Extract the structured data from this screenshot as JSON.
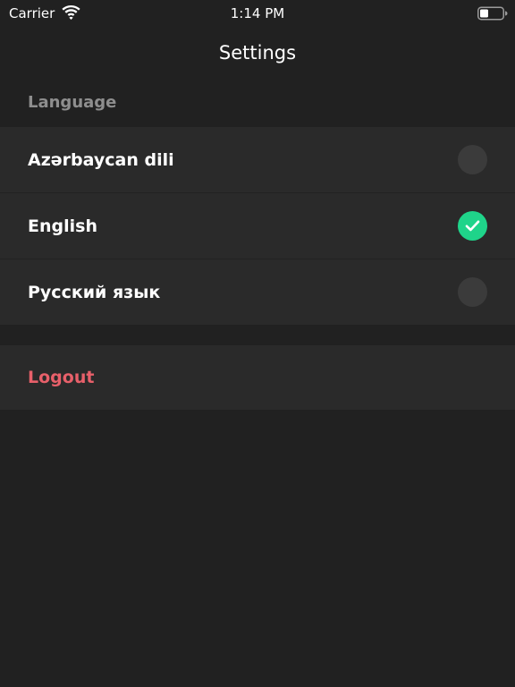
{
  "status_bar": {
    "carrier": "Carrier",
    "time": "1:14 PM",
    "wifi_icon": "wifi-icon",
    "battery_icon": "battery-icon"
  },
  "header": {
    "title": "Settings"
  },
  "language_section": {
    "title": "Language",
    "options": [
      {
        "label": "Azərbaycan dili",
        "selected": false
      },
      {
        "label": "English",
        "selected": true
      },
      {
        "label": "Русский язык",
        "selected": false
      }
    ]
  },
  "logout": {
    "label": "Logout"
  },
  "colors": {
    "background": "#212121",
    "row_background": "#2a2a2a",
    "section_header": "#8e8e8e",
    "radio_unselected": "#3b3b3b",
    "radio_selected": "#1fd48a",
    "logout": "#e8606a"
  }
}
